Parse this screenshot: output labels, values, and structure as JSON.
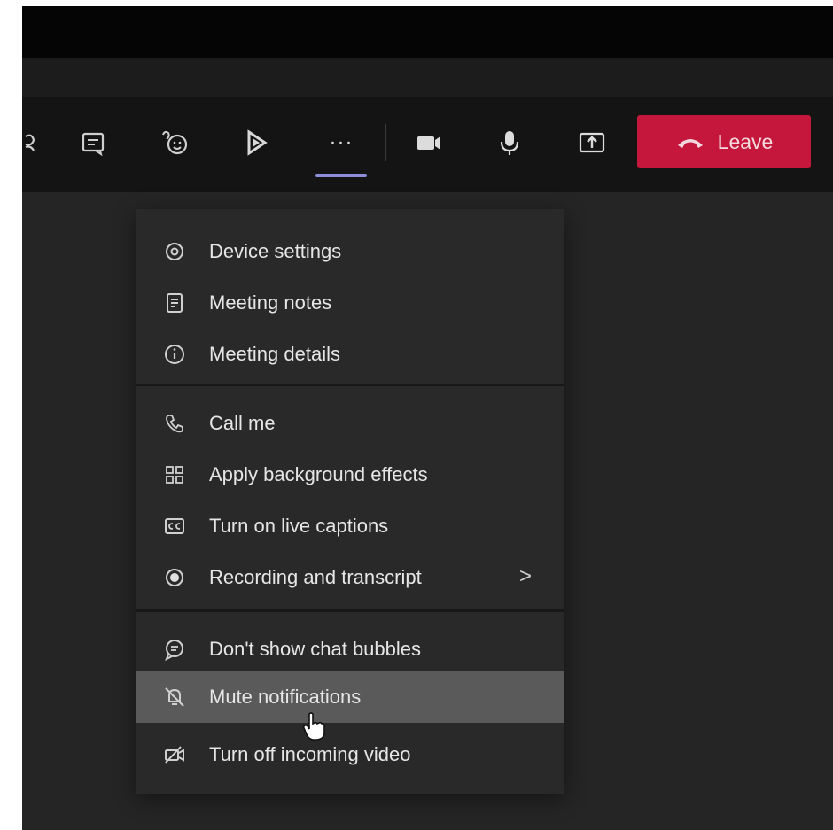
{
  "toolbar": {
    "icons": [
      "people-icon",
      "chat-icon",
      "reactions-icon",
      "apps-icon",
      "more-actions-icon",
      "camera-icon",
      "microphone-icon",
      "share-screen-icon"
    ],
    "more_label": "···",
    "leave_label": "Leave",
    "leave_color": "#c4173b",
    "active_underline_color": "#8c8fd8"
  },
  "menu": {
    "items": [
      {
        "label": "Device settings",
        "icon": "gear-icon"
      },
      {
        "label": "Meeting notes",
        "icon": "notes-icon"
      },
      {
        "label": "Meeting details",
        "icon": "info-icon"
      },
      {
        "label": "Call me",
        "icon": "phone-icon"
      },
      {
        "label": "Apply background effects",
        "icon": "background-effects-icon"
      },
      {
        "label": "Turn on live captions",
        "icon": "captions-icon"
      },
      {
        "label": "Recording and transcript",
        "icon": "record-icon",
        "chevron": ">"
      },
      {
        "label": "Don't show chat bubbles",
        "icon": "chat-bubble-icon"
      },
      {
        "label": "Mute notifications",
        "icon": "mute-notifications-icon",
        "hovered": true
      },
      {
        "label": "Turn off incoming video",
        "icon": "video-off-icon"
      }
    ]
  }
}
